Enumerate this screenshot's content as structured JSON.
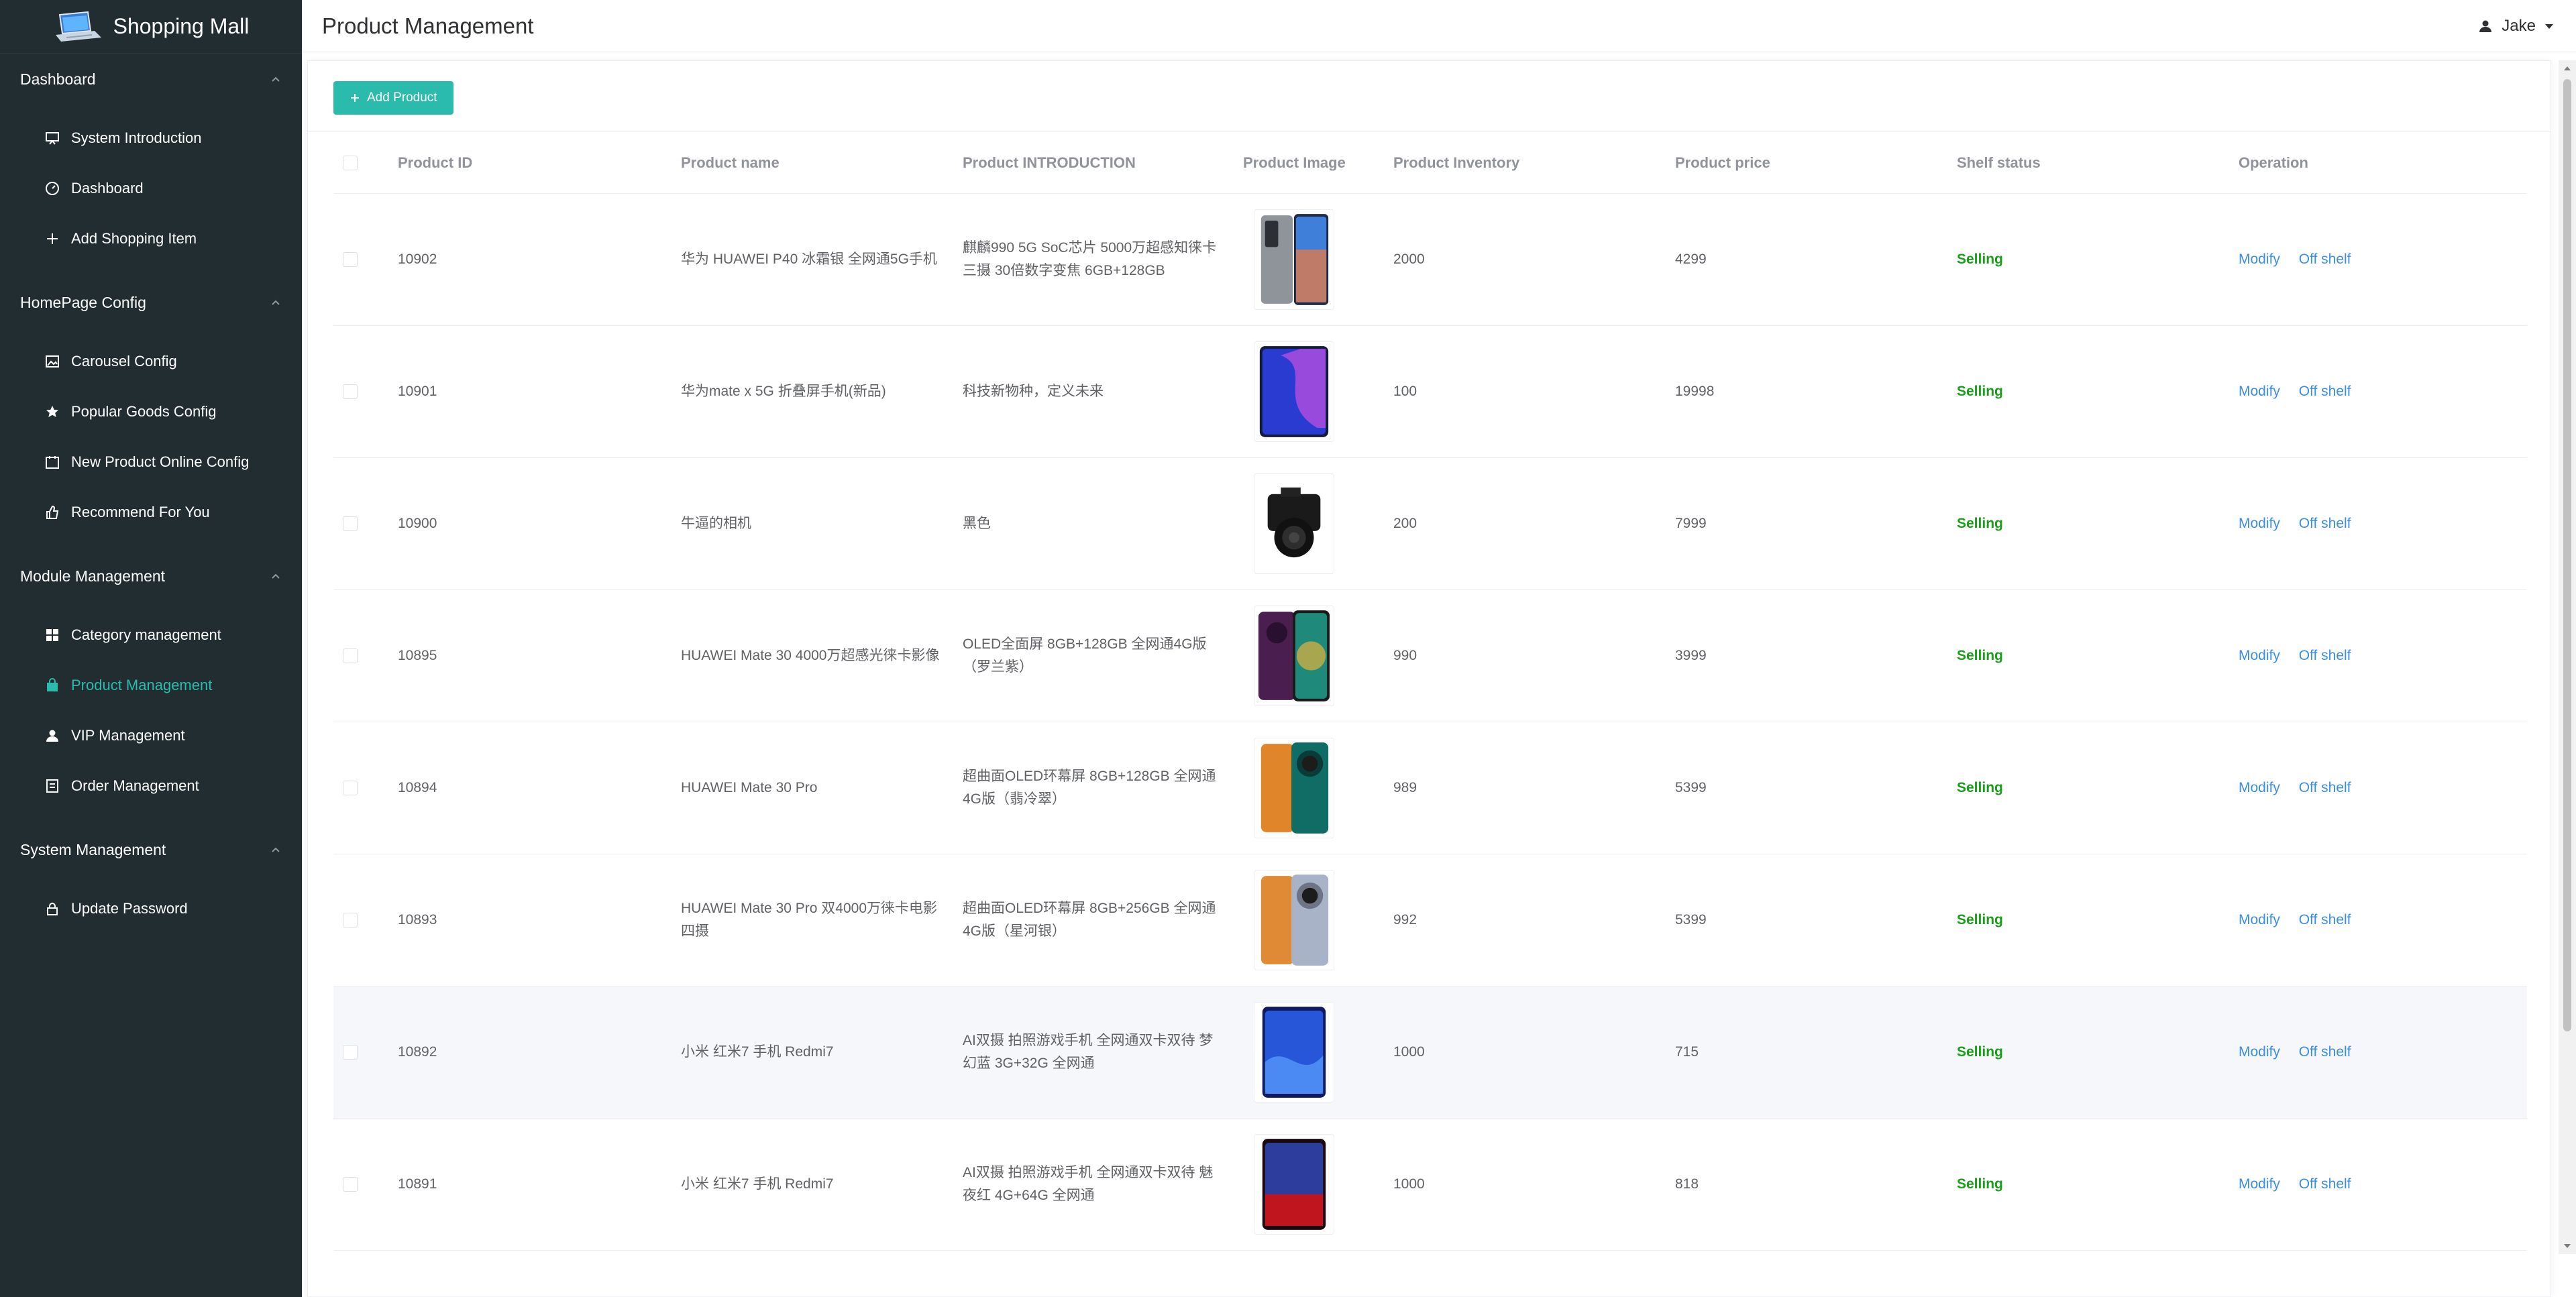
{
  "brand": {
    "title": "Shopping Mall"
  },
  "sidebar": {
    "groups": [
      {
        "label": "Dashboard",
        "items": [
          "System Introduction",
          "Dashboard",
          "Add Shopping Item"
        ]
      },
      {
        "label": "HomePage Config",
        "items": [
          "Carousel Config",
          "Popular Goods Config",
          "New Product Online Config",
          "Recommend For You"
        ]
      },
      {
        "label": "Module Management",
        "items": [
          "Category management",
          "Product Management",
          "VIP Management",
          "Order Management"
        ]
      },
      {
        "label": "System Management",
        "items": [
          "Update Password"
        ]
      }
    ],
    "active_item": "Product Management"
  },
  "header": {
    "title": "Product Management",
    "user": "Jake"
  },
  "toolbar": {
    "add_label": "Add Product"
  },
  "table": {
    "columns": [
      "Product ID",
      "Product name",
      "Product INTRODUCTION",
      "Product Image",
      "Product Inventory",
      "Product price",
      "Shelf status",
      "Operation"
    ],
    "rows": [
      {
        "id": "10902",
        "name": "华为 HUAWEI P40 冰霜银 全网通5G手机",
        "intro": "麒麟990 5G SoC芯片 5000万超感知徕卡三摄 30倍数字变焦 6GB+128GB",
        "inventory": "2000",
        "price": "4299",
        "status": "Selling",
        "image": "phone-silver"
      },
      {
        "id": "10901",
        "name": "华为mate x 5G 折叠屏手机(新品)",
        "intro": "科技新物种，定义未来",
        "inventory": "100",
        "price": "19998",
        "status": "Selling",
        "image": "phone-blue-purple"
      },
      {
        "id": "10900",
        "name": "牛逼的相机",
        "intro": "黑色",
        "inventory": "200",
        "price": "7999",
        "status": "Selling",
        "image": "camera-black"
      },
      {
        "id": "10895",
        "name": "HUAWEI Mate 30 4000万超感光徕卡影像",
        "intro": "OLED全面屏 8GB+128GB 全网通4G版（罗兰紫）",
        "inventory": "990",
        "price": "3999",
        "status": "Selling",
        "image": "phone-purple"
      },
      {
        "id": "10894",
        "name": "HUAWEI Mate 30 Pro",
        "intro": "超曲面OLED环幕屏 8GB+128GB 全网通4G版（翡冷翠）",
        "inventory": "989",
        "price": "5399",
        "status": "Selling",
        "image": "phone-orange-green"
      },
      {
        "id": "10893",
        "name": "HUAWEI Mate 30 Pro 双4000万徕卡电影四摄",
        "intro": "超曲面OLED环幕屏 8GB+256GB 全网通4G版（星河银）",
        "inventory": "992",
        "price": "5399",
        "status": "Selling",
        "image": "phone-orange-silver"
      },
      {
        "id": "10892",
        "name": "小米 红米7 手机 Redmi7",
        "intro": "AI双摄 拍照游戏手机 全网通双卡双待 梦幻蓝 3G+32G 全网通",
        "inventory": "1000",
        "price": "715",
        "status": "Selling",
        "image": "phone-dream-blue"
      },
      {
        "id": "10891",
        "name": "小米 红米7 手机 Redmi7",
        "intro": "AI双摄 拍照游戏手机 全网通双卡双待 魅夜红 4G+64G 全网通",
        "inventory": "1000",
        "price": "818",
        "status": "Selling",
        "image": "phone-night-red"
      }
    ],
    "operations": {
      "modify": "Modify",
      "off_shelf": "Off shelf"
    }
  },
  "colors": {
    "sidebar_bg": "#222d32",
    "accent": "#2bbbad",
    "link": "#3a8ee6",
    "status_green": "#1a9e1a"
  }
}
